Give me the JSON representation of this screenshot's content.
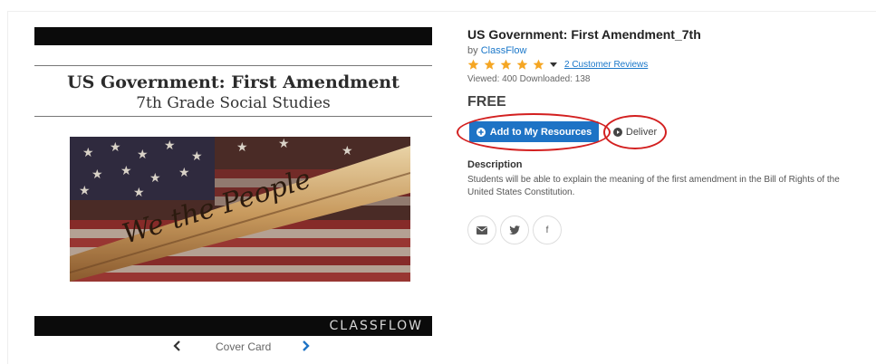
{
  "preview": {
    "title_line1": "US Government: First Amendment",
    "title_line2": "7th Grade Social Studies",
    "brand": "CLASSFLOW",
    "nav_label": "Cover Card"
  },
  "resource": {
    "title": "US Government: First Amendment_7th",
    "by_prefix": "by",
    "author": "ClassFlow",
    "rating": 5,
    "reviews_label": "2 Customer Reviews",
    "stats": "Viewed: 400  Downloaded: 138",
    "price": "FREE",
    "add_button": "Add to My Resources",
    "deliver_button": "Deliver",
    "description_heading": "Description",
    "description": "Students will be able to explain the meaning of the first amendment in the Bill of Rights of the United States Constitution."
  },
  "share": {
    "email_icon": "envelope-icon",
    "twitter_icon": "twitter-icon",
    "facebook_label": "f"
  },
  "colors": {
    "accent": "#1e73c5",
    "link": "#1a77c9",
    "star": "#f5a623",
    "highlight_ring": "#d32020"
  }
}
